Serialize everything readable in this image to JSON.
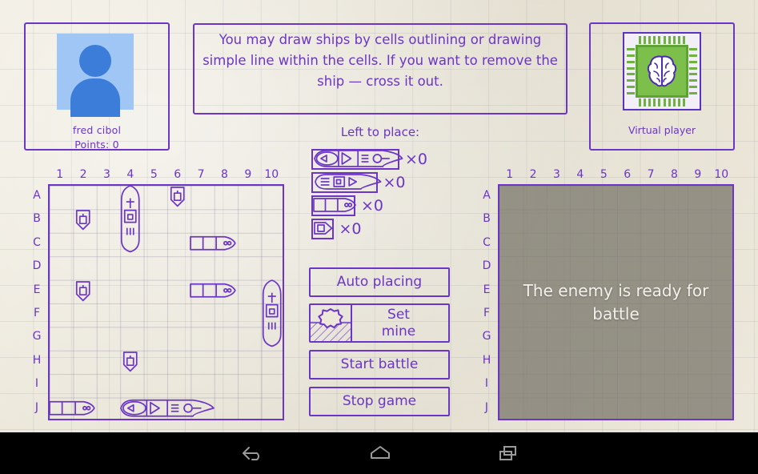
{
  "player": {
    "name": "fred cibol",
    "points_label": "Points: 0",
    "avatar_icon": "person-avatar-icon"
  },
  "instruction": {
    "text": "You may draw ships by cells outlining or drawing simple line within the cells. If you want to remove the ship — cross it out."
  },
  "ai": {
    "name": "Virtual player",
    "avatar_icon": "brain-chip-icon"
  },
  "boards": {
    "columns": [
      "1",
      "2",
      "3",
      "4",
      "5",
      "6",
      "7",
      "8",
      "9",
      "10"
    ],
    "rows": [
      "A",
      "B",
      "C",
      "D",
      "E",
      "F",
      "G",
      "H",
      "I",
      "J"
    ],
    "player_ships": [
      {
        "size": 1,
        "orientation": "v",
        "col": 6,
        "row": 1,
        "name": "submarine"
      },
      {
        "size": 3,
        "orientation": "v",
        "col": 4,
        "row": 1,
        "name": "cruiser"
      },
      {
        "size": 1,
        "orientation": "v",
        "col": 2,
        "row": 2,
        "name": "submarine"
      },
      {
        "size": 2,
        "orientation": "h",
        "col": 7,
        "row": 3,
        "name": "destroyer"
      },
      {
        "size": 1,
        "orientation": "v",
        "col": 2,
        "row": 5,
        "name": "submarine"
      },
      {
        "size": 2,
        "orientation": "h",
        "col": 7,
        "row": 5,
        "name": "destroyer"
      },
      {
        "size": 3,
        "orientation": "v",
        "col": 10,
        "row": 5,
        "name": "cruiser"
      },
      {
        "size": 1,
        "orientation": "v",
        "col": 4,
        "row": 8,
        "name": "submarine"
      },
      {
        "size": 2,
        "orientation": "h",
        "col": 1,
        "row": 10,
        "name": "destroyer"
      },
      {
        "size": 4,
        "orientation": "h",
        "col": 4,
        "row": 10,
        "name": "battleship"
      }
    ],
    "enemy_status": "The enemy is ready for battle"
  },
  "fleet": {
    "title": "Left to place:",
    "items": [
      {
        "size": 4,
        "count": "×0",
        "name": "battleship"
      },
      {
        "size": 3,
        "count": "×0",
        "name": "cruiser"
      },
      {
        "size": 2,
        "count": "×0",
        "name": "destroyer"
      },
      {
        "size": 1,
        "count": "×0",
        "name": "submarine"
      }
    ]
  },
  "buttons": {
    "auto_placing": "Auto placing",
    "set_mine": "Set\nmine",
    "set_mine_line1": "Set",
    "set_mine_line2": "mine",
    "start_battle": "Start battle",
    "stop_game": "Stop game",
    "mine_icon": "naval-mine-icon"
  },
  "navbar": {
    "back": "back-icon",
    "home": "home-icon",
    "recents": "recents-icon"
  },
  "colors": {
    "ink": "#6B36C6",
    "paper": "#EDE8D9",
    "veil": "#807C70",
    "avatar_bg": "#9FC6F5",
    "avatar_fg": "#3B7DD8",
    "chip_green": "#7CBF4B"
  }
}
